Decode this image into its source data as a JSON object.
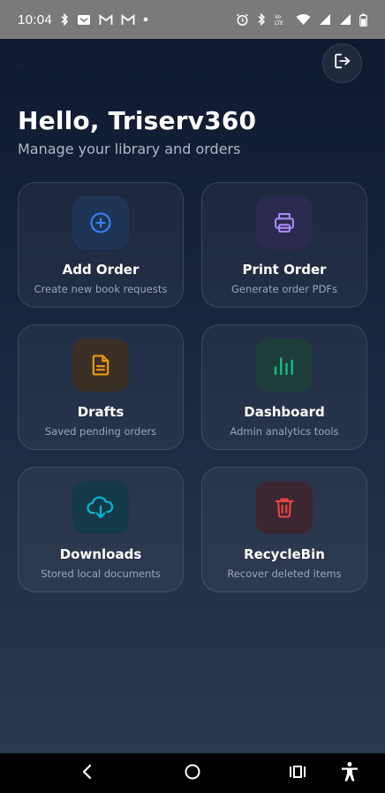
{
  "status_bar": {
    "time": "10:04",
    "left_icons": [
      "bluetooth-icon",
      "app-icon",
      "gmail-icon",
      "gmail-icon",
      "dot-icon"
    ],
    "right_icons": [
      "alarm-icon",
      "bluetooth-icon",
      "volte-icon",
      "wifi-icon",
      "signal-icon",
      "signal-icon",
      "battery-icon"
    ]
  },
  "header": {
    "greeting": "Hello, Triserv360",
    "subtitle": "Manage your library and orders"
  },
  "cards": [
    {
      "title": "Add Order",
      "desc": "Create new book requests",
      "icon": "plus-circle-icon",
      "color": "#3b82f6",
      "bg": "#1e3556"
    },
    {
      "title": "Print Order",
      "desc": "Generate order PDFs",
      "icon": "printer-icon",
      "color": "#a78bfa",
      "bg": "#2b2a4f"
    },
    {
      "title": "Drafts",
      "desc": "Saved pending orders",
      "icon": "document-icon",
      "color": "#f59e0b",
      "bg": "#3a3026"
    },
    {
      "title": "Dashboard",
      "desc": "Admin analytics tools",
      "icon": "bar-chart-icon",
      "color": "#10b981",
      "bg": "#1c3d3a"
    },
    {
      "title": "Downloads",
      "desc": "Stored local documents",
      "icon": "cloud-download-icon",
      "color": "#06b6d4",
      "bg": "#143a4a"
    },
    {
      "title": "RecycleBin",
      "desc": "Recover deleted items",
      "icon": "trash-icon",
      "color": "#ef4444",
      "bg": "#3b2631"
    }
  ],
  "colors": {
    "background_top": "#0f1a30",
    "background_bottom": "#2b394f",
    "status_bar": "#7a7a7a"
  }
}
